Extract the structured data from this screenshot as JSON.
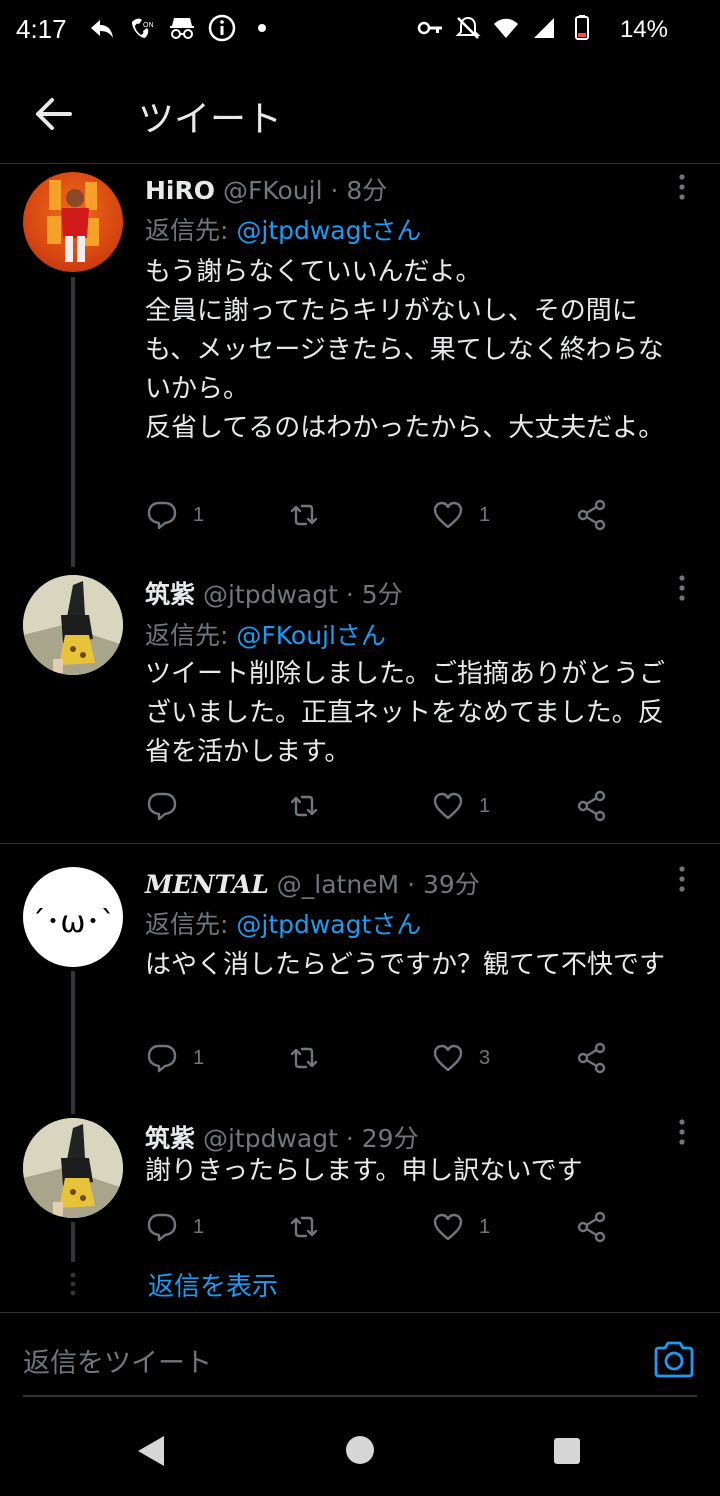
{
  "status_bar": {
    "time": "4:17",
    "battery": "14%",
    "left_icons": [
      "reply-arrow-icon",
      "volte-icon",
      "incognito-icon",
      "info-icon",
      "dot-icon"
    ],
    "right_icons": [
      "vpn-key-icon",
      "mute-bell-icon",
      "wifi-icon",
      "signal-icon",
      "battery-icon"
    ]
  },
  "header": {
    "title": "ツイート"
  },
  "tweets": [
    {
      "name": "HiRO",
      "handle": "@FKoujl",
      "time": "8分",
      "reply_prefix": "返信先: ",
      "reply_to": "@jtpdwagtさん",
      "body": "もう謝らなくていいんだよ。\n全員に謝ってたらキリがないし、その間にも、メッセージきたら、果てしなく終わらないから。\n反省してるのはわかったから、大丈夫だよ。",
      "replies": "1",
      "retweets": "",
      "likes": "1"
    },
    {
      "name": "筑紫",
      "handle": "@jtpdwagt",
      "time": "5分",
      "reply_prefix": "返信先: ",
      "reply_to": "@FKoujlさん",
      "body": "ツイート削除しました。ご指摘ありがとうございました。正直ネットをなめてました。反省を活かします。",
      "replies": "",
      "retweets": "",
      "likes": "1"
    },
    {
      "name": "MENTAL",
      "handle": "@_latneM",
      "time": "39分",
      "reply_prefix": "返信先: ",
      "reply_to": "@jtpdwagtさん",
      "body": "はやく消したらどうですか？観てて不快です",
      "replies": "1",
      "retweets": "",
      "likes": "3",
      "avatar_text": "´･ω･`"
    },
    {
      "name": "筑紫",
      "handle": "@jtpdwagt",
      "time": "29分",
      "body": "謝りきったらします。申し訳ないです",
      "replies": "1",
      "retweets": "",
      "likes": "1"
    }
  ],
  "show_replies": "返信を表示",
  "compose": {
    "placeholder": "返信をツイート"
  },
  "colors": {
    "accent": "#1d9bf0",
    "muted": "#71767b",
    "text": "#e7e9ea",
    "background": "#000000"
  }
}
